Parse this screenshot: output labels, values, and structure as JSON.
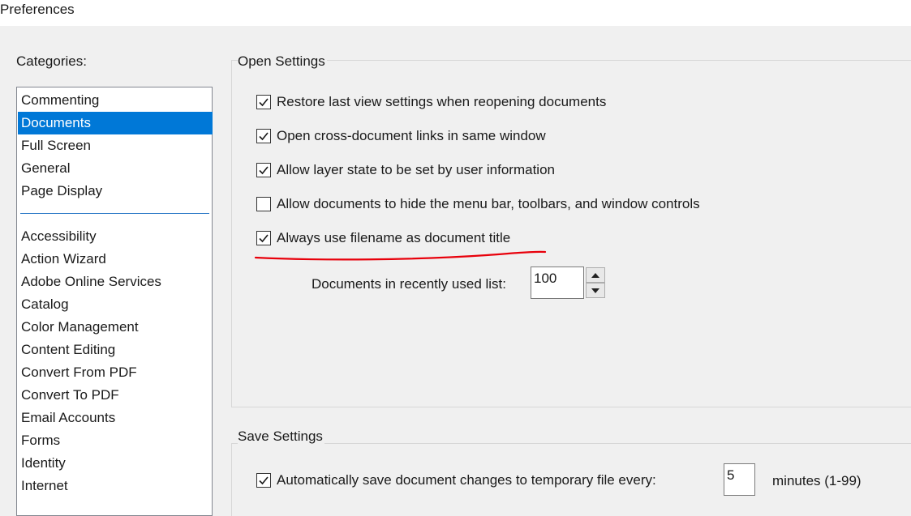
{
  "window": {
    "title": "Preferences"
  },
  "categories": {
    "label": "Categories:",
    "top_items": [
      "Commenting",
      "Documents",
      "Full Screen",
      "General",
      "Page Display"
    ],
    "selected": "Documents",
    "other_items": [
      "Accessibility",
      "Action Wizard",
      "Adobe Online Services",
      "Catalog",
      "Color Management",
      "Content Editing",
      "Convert From PDF",
      "Convert To PDF",
      "Email Accounts",
      "Forms",
      "Identity",
      "Internet"
    ]
  },
  "open_settings": {
    "title": "Open Settings",
    "options": [
      {
        "label": "Restore last view settings when reopening documents",
        "checked": true
      },
      {
        "label": "Open cross-document links in same window",
        "checked": true
      },
      {
        "label": "Allow layer state to be set by user information",
        "checked": true
      },
      {
        "label": "Allow documents to hide the menu bar, toolbars, and window controls",
        "checked": false
      },
      {
        "label": "Always use filename as document title",
        "checked": true
      }
    ],
    "recent_list_label": "Documents in recently used list:",
    "recent_list_value": "100"
  },
  "save_settings": {
    "title": "Save Settings",
    "autosave_label": "Automatically save document changes to temporary file every:",
    "autosave_checked": true,
    "autosave_value": "5",
    "autosave_unit": "minutes (1-99)"
  },
  "colors": {
    "selection": "#0078d7",
    "annotation": "#e8000b"
  }
}
